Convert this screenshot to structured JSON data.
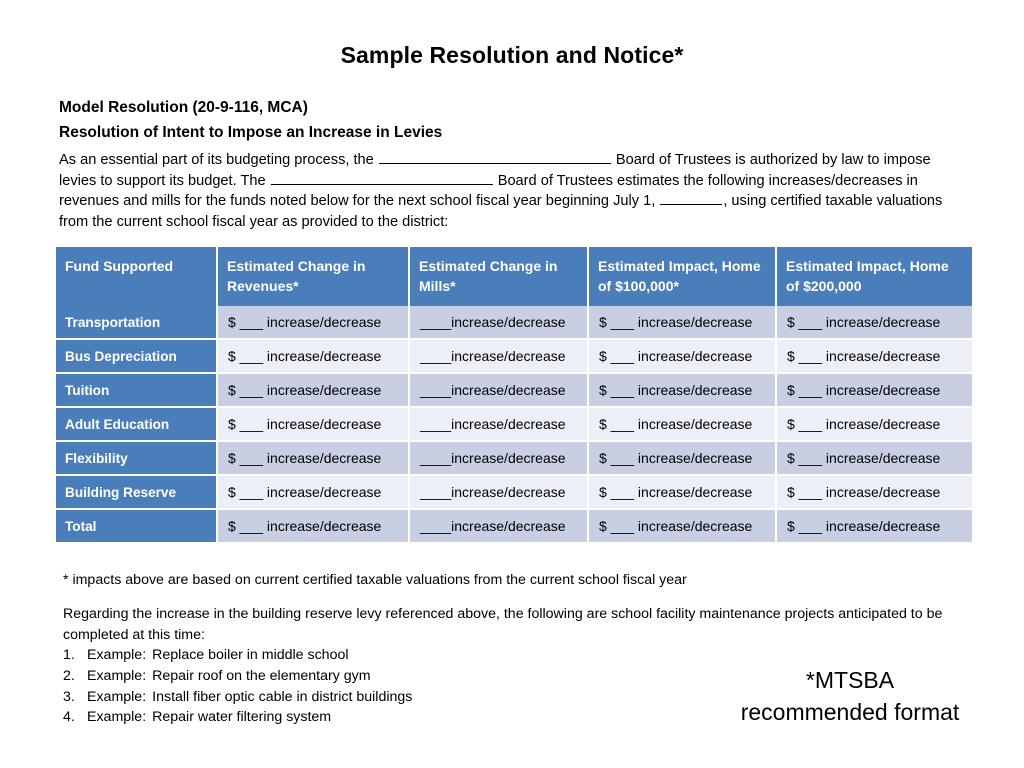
{
  "document": {
    "title": "Sample Resolution and Notice*",
    "headings": [
      "Model Resolution (20-9-116, MCA)",
      "Resolution of Intent to Impose an Increase in Levies"
    ],
    "intro": {
      "seg1": "As an essential part of its budgeting process, the ",
      "seg2": " Board of Trustees is authorized by law to impose levies to support its budget.  The ",
      "seg3": " Board of Trustees estimates the following increases/decreases in revenues and mills for the funds noted below for the next school fiscal year beginning July 1, ",
      "seg4": ", using certified taxable valuations from the current school fiscal year as provided to the district:"
    },
    "footnote": "* impacts above are based on current certified taxable valuations from the current school fiscal year",
    "regarding": "Regarding the increase in the building reserve levy referenced above, the following are school facility maintenance projects anticipated to be completed at this time:",
    "examples": [
      {
        "num": "1.",
        "label": "Example:",
        "text": "Replace boiler in middle school"
      },
      {
        "num": "2.",
        "label": "Example:",
        "text": "Repair roof on the elementary gym"
      },
      {
        "num": "3.",
        "label": "Example:",
        "text": "Install fiber optic cable in district buildings"
      },
      {
        "num": "4.",
        "label": "Example:",
        "text": "Repair water filtering system"
      }
    ],
    "mtsba": {
      "line1": "*MTSBA",
      "line2": "recommended format"
    }
  },
  "table": {
    "headers": [
      "Fund Supported",
      "Estimated Change in Revenues*",
      "Estimated Change in Mills*",
      "Estimated Impact, Home of $100,000*",
      "Estimated Impact, Home of $200,000"
    ],
    "rows": [
      {
        "label": "Transportation",
        "revenues": "$ ___ increase/decrease",
        "mills": "____increase/decrease",
        "impact100k": "$ ___ increase/decrease",
        "impact200k": "$ ___ increase/decrease"
      },
      {
        "label": "Bus Depreciation",
        "revenues": "$ ___ increase/decrease",
        "mills": "____increase/decrease",
        "impact100k": "$ ___ increase/decrease",
        "impact200k": "$ ___ increase/decrease"
      },
      {
        "label": "Tuition",
        "revenues": "$ ___ increase/decrease",
        "mills": "____increase/decrease",
        "impact100k": "$ ___ increase/decrease",
        "impact200k": "$ ___ increase/decrease"
      },
      {
        "label": "Adult Education",
        "revenues": "$ ___ increase/decrease",
        "mills": "____increase/decrease",
        "impact100k": "$ ___ increase/decrease",
        "impact200k": "$ ___ increase/decrease"
      },
      {
        "label": "Flexibility",
        "revenues": "$ ___ increase/decrease",
        "mills": "____increase/decrease",
        "impact100k": "$ ___ increase/decrease",
        "impact200k": "$ ___ increase/decrease"
      },
      {
        "label": "Building Reserve",
        "revenues": "$ ___ increase/decrease",
        "mills": "____increase/decrease",
        "impact100k": "$ ___ increase/decrease",
        "impact200k": "$ ___ increase/decrease"
      },
      {
        "label": "Total",
        "revenues": "$ ___ increase/decrease",
        "mills": "____increase/decrease",
        "impact100k": "$ ___ increase/decrease",
        "impact200k": "$ ___ increase/decrease"
      }
    ]
  },
  "colors": {
    "header_blue": "#4a7ebb",
    "band_dark": "#c8cfe3",
    "band_light": "#eceff7",
    "text": "#000000",
    "header_text": "#ffffff"
  }
}
